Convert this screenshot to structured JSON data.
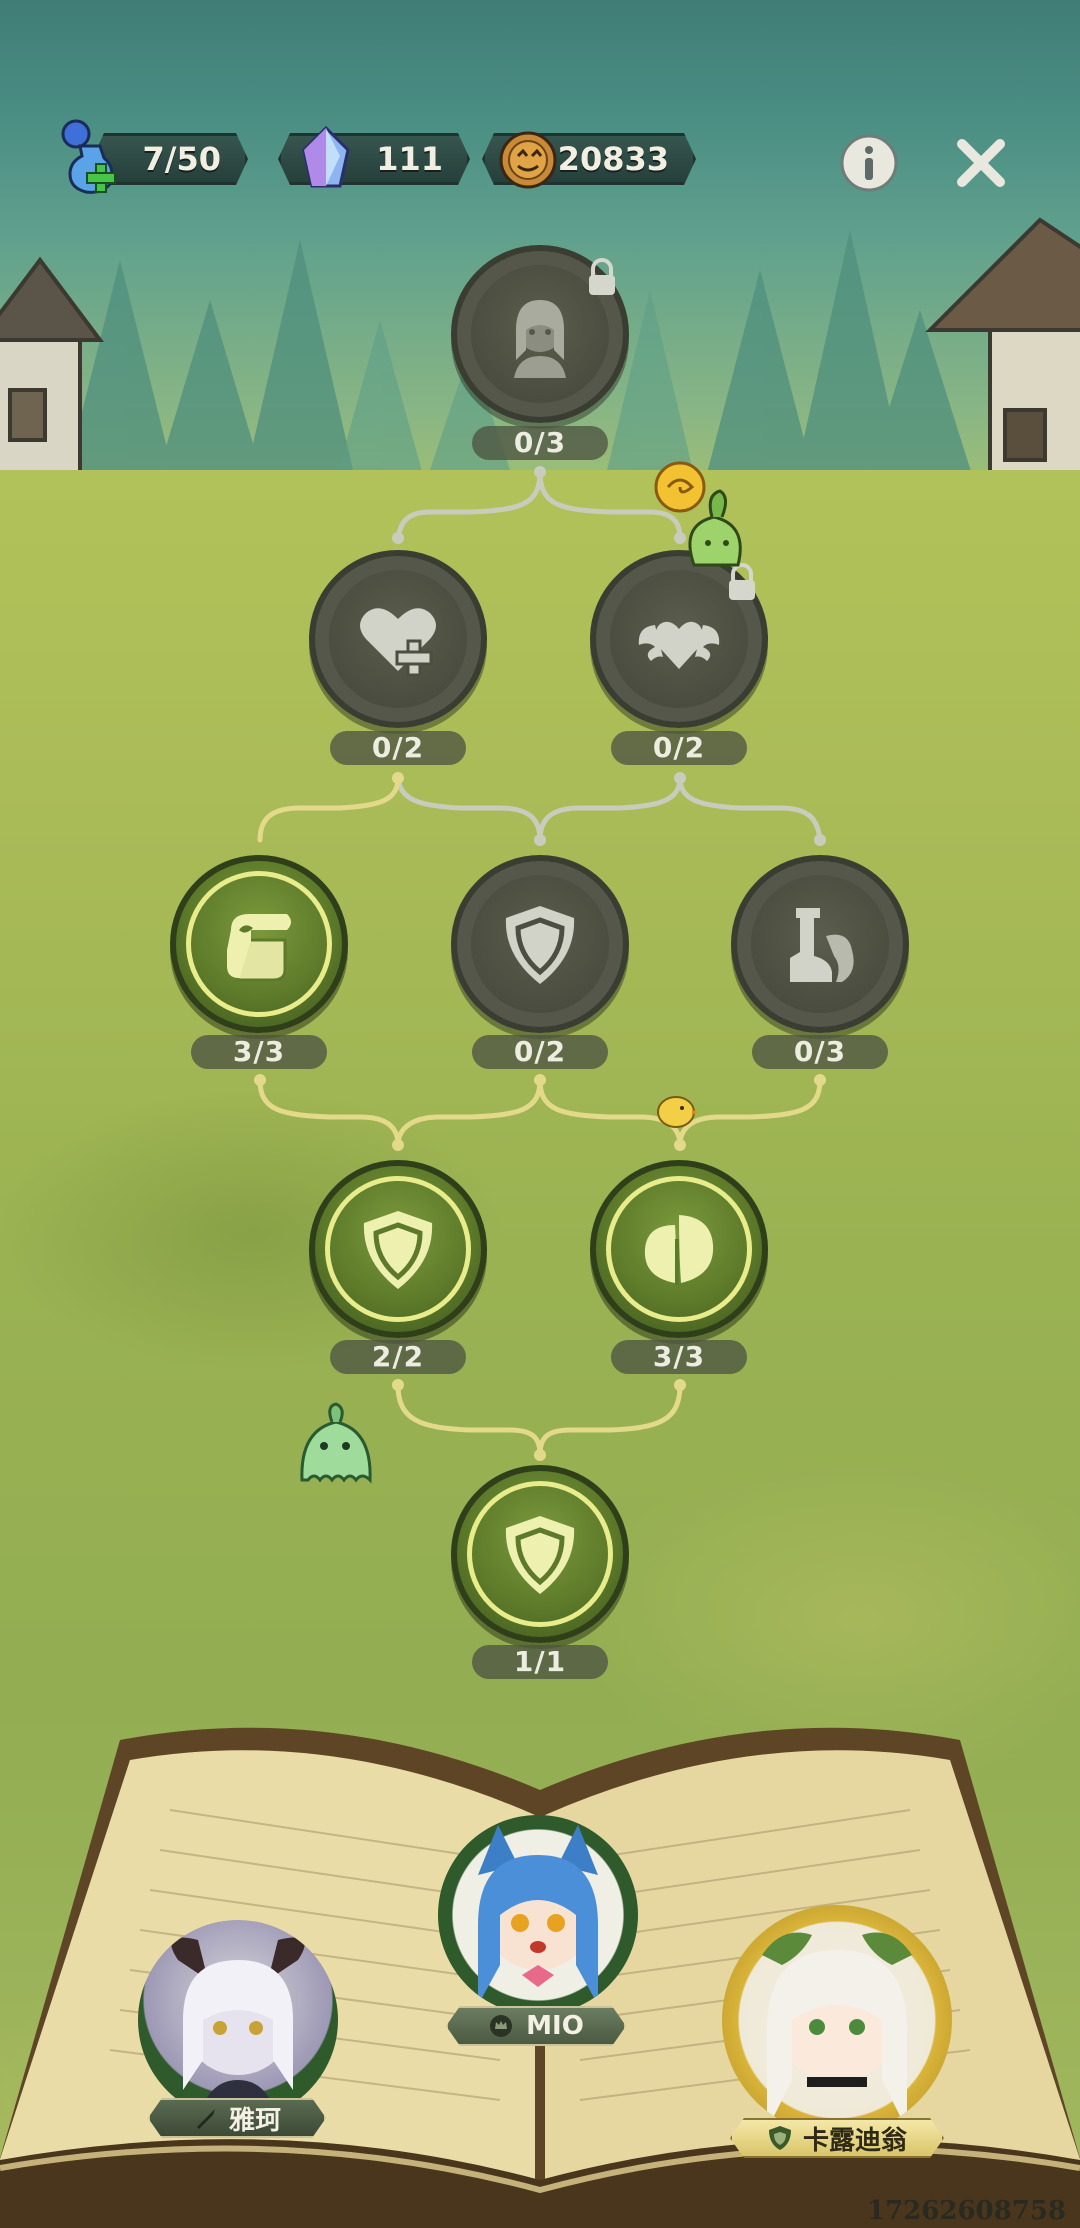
{
  "hud": {
    "stamina": "7/50",
    "crystals": "111",
    "coins": "20833"
  },
  "tree": {
    "top": "0/3",
    "row2_left": "0/2",
    "row2_right": "0/2",
    "row3_left": "3/3",
    "row3_mid": "0/2",
    "row3_right": "0/3",
    "row4_left": "2/2",
    "row4_right": "3/3",
    "bottom": "1/1"
  },
  "characters": {
    "left": "雅珂",
    "center": "MIO",
    "right": "卡露迪翁"
  },
  "watermark": "1726260875​8",
  "colors": {
    "unlocked_path": "#e3d98a",
    "locked_path": "#c9cbbd",
    "node_done_ring": "#e8ec8a"
  }
}
